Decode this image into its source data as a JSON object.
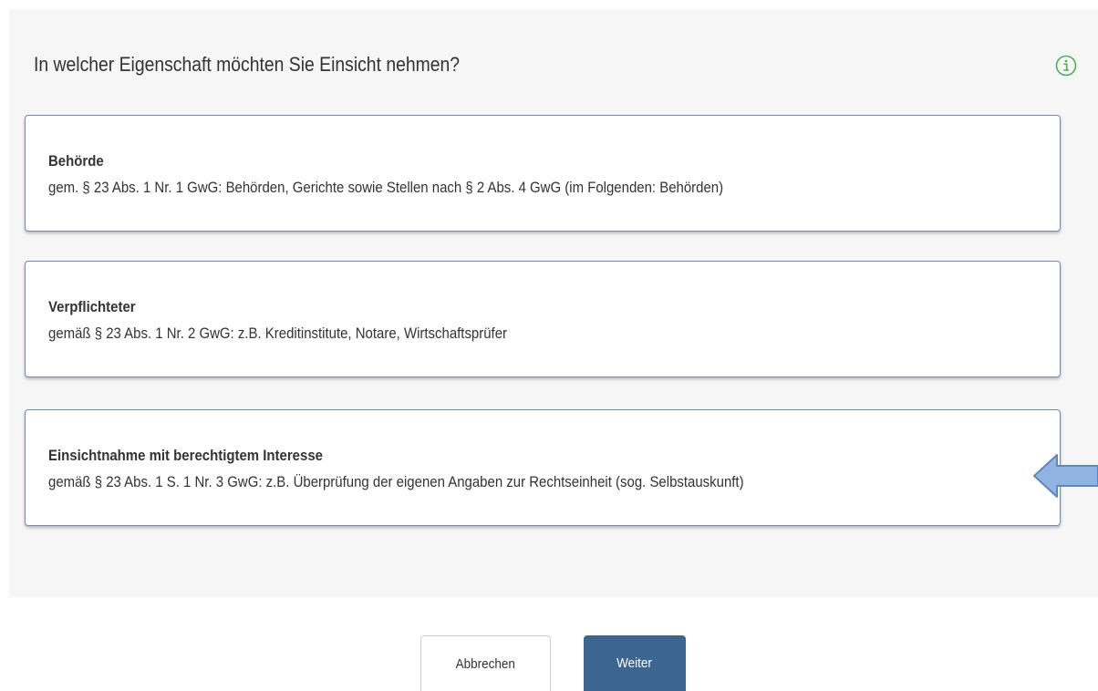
{
  "dialog": {
    "heading": "In welcher Eigenschaft möchten Sie Einsicht nehmen?",
    "info_icon": "info-circle-icon",
    "info_icon_color": "#4caf50"
  },
  "options": [
    {
      "title": "Behörde",
      "description": "gem. § 23 Abs. 1 Nr. 1 GwG: Behörden, Gerichte sowie Stellen nach § 2 Abs. 4 GwG (im Folgenden: Behörden)"
    },
    {
      "title": "Verpflichteter",
      "description": "gemäß § 23 Abs. 1 Nr. 2 GwG: z.B. Kreditinstitute, Notare, Wirtschaftsprüfer"
    },
    {
      "title": "Einsichtnahme mit berechtigtem Interesse",
      "description": "gemäß § 23 Abs. 1 S. 1 Nr. 3 GwG: z.B. Überprüfung der eigenen Angaben zur Rechtseinheit (sog. Selbstauskunft)"
    }
  ],
  "pointer": {
    "icon": "left-arrow-icon",
    "color": "#8fb3e3"
  },
  "buttons": {
    "cancel_label": "Abbrechen",
    "next_label": "Weiter",
    "next_color": "#3c6592"
  }
}
